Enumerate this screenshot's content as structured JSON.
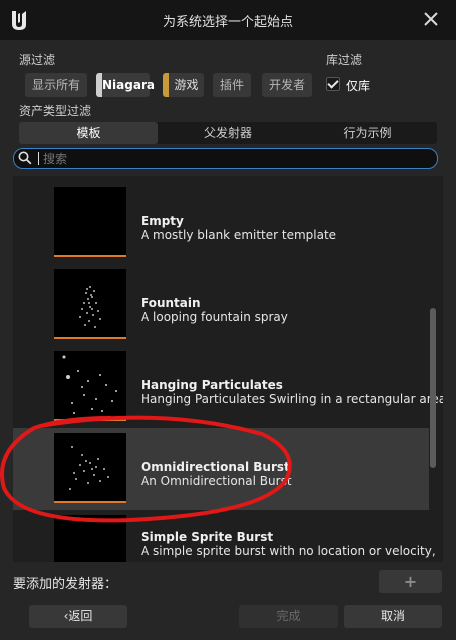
{
  "window": {
    "title": "为系统选择一个起始点"
  },
  "source_filter": {
    "label": "源过滤",
    "buttons": [
      {
        "label": "显示所有",
        "active": false,
        "color": ""
      },
      {
        "label": "Niagara",
        "active": true,
        "color": "#cfcfcf"
      },
      {
        "label": "游戏",
        "active": false,
        "color": "#c79a3a"
      },
      {
        "label": "插件",
        "active": false,
        "color": ""
      },
      {
        "label": "开发者",
        "active": false,
        "color": ""
      }
    ]
  },
  "library_filter": {
    "label": "库过滤",
    "checkbox_label": "仅库",
    "checked": true
  },
  "asset_type_filter": {
    "label": "资产类型过滤",
    "tabs": [
      {
        "label": "模板",
        "active": true
      },
      {
        "label": "父发射器",
        "active": false
      },
      {
        "label": "行为示例",
        "active": false
      }
    ]
  },
  "search": {
    "placeholder": "搜索",
    "value": ""
  },
  "emitters": [
    {
      "name": "Empty",
      "description": "A mostly blank emitter template",
      "selected": false
    },
    {
      "name": "Fountain",
      "description": "A looping fountain spray",
      "selected": false
    },
    {
      "name": "Hanging Particulates",
      "description": "Hanging Particulates Swirling in a rectangular area",
      "selected": false
    },
    {
      "name": "Omnidirectional Burst",
      "description": "An Omnidirectional Burst",
      "selected": true
    },
    {
      "name": "Simple Sprite Burst",
      "description": "A simple sprite burst with no location or velocity,",
      "selected": false
    }
  ],
  "footer": {
    "emitters_to_add_label": "要添加的发射器：",
    "add_label": "+",
    "back_label": "返回",
    "done_label": "完成",
    "cancel_label": "取消"
  },
  "colors": {
    "accent_orange": "#e07a2b",
    "focus_blue": "#3b7fc4",
    "annotation_red": "#e01818"
  }
}
